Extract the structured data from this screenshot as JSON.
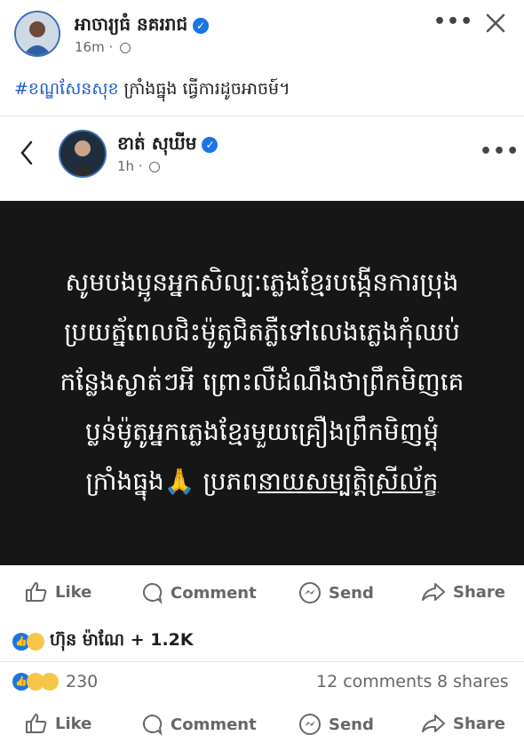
{
  "outer_post": {
    "author": "អាចារ្យធំ នគររាជ",
    "time": "16m",
    "caption_hashtag": "#ខណ្ឌសែនសុខ",
    "caption_text": " ក្រាំងធ្នុង ធ្វើការដូចអាចម៍។"
  },
  "shared_post": {
    "author": "ខាត់ សុឃីម",
    "time": "1h",
    "card_lines": [
      "សូមបងប្អូនអ្នកសិល្បៈភ្លេងខ្មែរបង្កើនការប្រុង",
      "ប្រយត្ន័ពេលជិះម៉ូតូជិតភ្លឺទៅលេងភ្លេងកុំឈប់",
      "កន្លែងស្ងាត់ៗអី ព្រោះលឺដំណឹងថាព្រឹកមិញគេ",
      "ប្លន់ម៉ូតូអ្នកភ្លេងខ្មែរមួយគ្រឿងព្រឹកមិញម្តុំ"
    ],
    "card_last_prefix": "ក្រាំងធ្នុង",
    "card_last_emoji": "🙏",
    "card_last_mid": " ប្រភព",
    "card_last_link": "នាយសម្បត្តិស្រីល័ក្ខ"
  },
  "actions": {
    "like": "Like",
    "comment": "Comment",
    "send": "Send",
    "share": "Share"
  },
  "shared_reactions": {
    "text": "ហ៊ុន ម៉ាណែ + 1.2K"
  },
  "outer_reactions": {
    "count": "230",
    "comments": "12 comments",
    "shares": "8 shares"
  },
  "colors": {
    "accent": "#1b74e4",
    "hashtag": "#1b5cc7",
    "card_bg": "#161616"
  },
  "icons": [
    "verified-icon",
    "globe-icon",
    "more-icon",
    "close-icon",
    "back-icon",
    "like-icon",
    "comment-icon",
    "send-icon",
    "share-icon"
  ]
}
